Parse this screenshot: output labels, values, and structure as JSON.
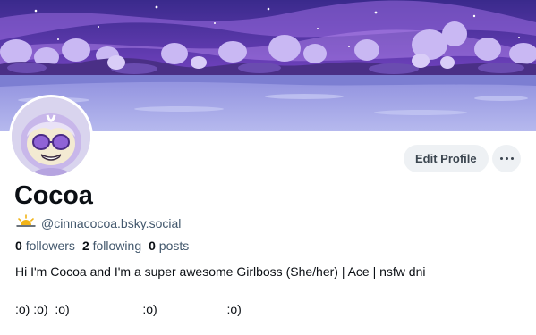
{
  "profile": {
    "display_name": "Cocoa",
    "handle": "@cinnacocoa.bsky.social",
    "followers_count": "0",
    "followers_label": "followers",
    "following_count": "2",
    "following_label": "following",
    "posts_count": "0",
    "posts_label": "posts",
    "bio_line1": "Hi I'm Cocoa and I'm a super awesome Girlboss (She/her) | Ace | nsfw dni",
    "bio_line2": ":o) :o)  :o)                     :o)                    :o)"
  },
  "actions": {
    "edit_label": "Edit Profile",
    "more_icon": "more-horizontal-icon"
  },
  "icons": {
    "handle_prefix": "sunrise-icon",
    "handle_prefix_color": "#f2b417"
  },
  "colors": {
    "banner_sky": "#5b3aa8",
    "banner_ground": "#a4a6e6",
    "button_bg": "#eef1f4",
    "muted_text": "#42576c"
  }
}
